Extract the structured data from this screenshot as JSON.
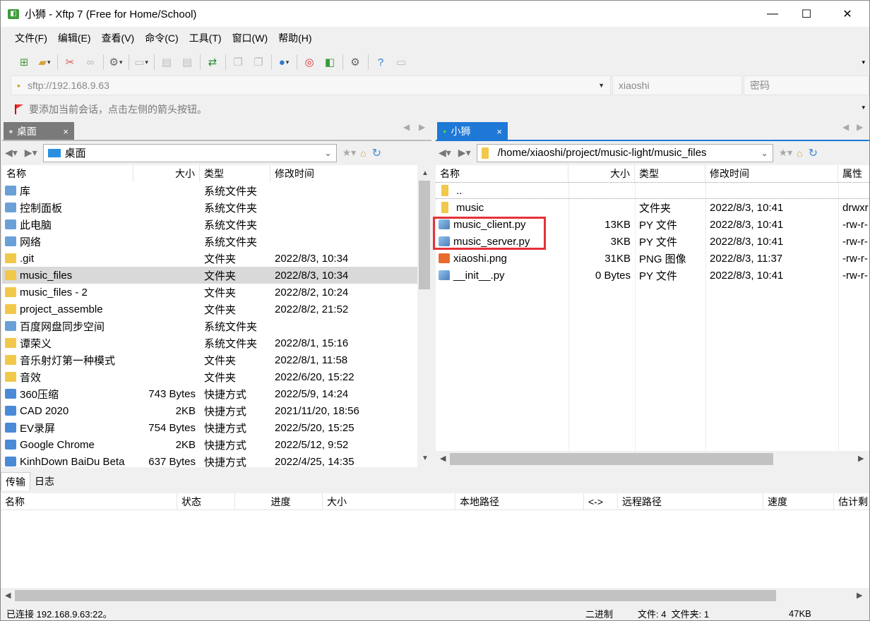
{
  "window": {
    "title": "小狮 - Xftp 7 (Free for Home/School)",
    "minimize": "—",
    "maximize": "☐",
    "close": "✕",
    "app_icon": "xftp-icon"
  },
  "menu": [
    "文件(F)",
    "编辑(E)",
    "查看(V)",
    "命令(C)",
    "工具(T)",
    "窗口(W)",
    "帮助(H)"
  ],
  "address": {
    "url": "sftp://192.168.9.63",
    "user": "xiaoshi",
    "password_placeholder": "密码"
  },
  "hint": "要添加当前会话，点击左侧的箭头按钮。",
  "left_tab": {
    "label": "桌面",
    "close": "×"
  },
  "right_tab": {
    "label": "小狮",
    "close": "×"
  },
  "left_path": "桌面",
  "right_path": "/home/xiaoshi/project/music-light/music_files",
  "left_columns": [
    "名称",
    "大小",
    "类型",
    "修改时间"
  ],
  "right_columns": [
    "名称",
    "大小",
    "类型",
    "修改时间",
    "属性"
  ],
  "left_files": [
    {
      "name": "库",
      "size": "",
      "type": "系统文件夹",
      "modified": "",
      "icon": "library-icon"
    },
    {
      "name": "控制面板",
      "size": "",
      "type": "系统文件夹",
      "modified": "",
      "icon": "control-panel-icon"
    },
    {
      "name": "此电脑",
      "size": "",
      "type": "系统文件夹",
      "modified": "",
      "icon": "computer-icon"
    },
    {
      "name": "网络",
      "size": "",
      "type": "系统文件夹",
      "modified": "",
      "icon": "network-icon"
    },
    {
      "name": ".git",
      "size": "",
      "type": "文件夹",
      "modified": "2022/8/3, 10:34",
      "icon": "folder-icon"
    },
    {
      "name": "music_files",
      "size": "",
      "type": "文件夹",
      "modified": "2022/8/3, 10:34",
      "icon": "folder-icon"
    },
    {
      "name": "music_files - 2",
      "size": "",
      "type": "文件夹",
      "modified": "2022/8/2, 10:24",
      "icon": "folder-icon"
    },
    {
      "name": "project_assemble",
      "size": "",
      "type": "文件夹",
      "modified": "2022/8/2, 21:52",
      "icon": "folder-icon"
    },
    {
      "name": "百度网盘同步空间",
      "size": "",
      "type": "系统文件夹",
      "modified": "",
      "icon": "baidu-sync-icon"
    },
    {
      "name": "谭荣义",
      "size": "",
      "type": "系统文件夹",
      "modified": "2022/8/1, 15:16",
      "icon": "user-folder-icon"
    },
    {
      "name": "音乐射灯第一种模式",
      "size": "",
      "type": "文件夹",
      "modified": "2022/8/1, 11:58",
      "icon": "folder-icon"
    },
    {
      "name": "音效",
      "size": "",
      "type": "文件夹",
      "modified": "2022/6/20, 15:22",
      "icon": "folder-icon"
    },
    {
      "name": "360压缩",
      "size": "743 Bytes",
      "type": "快捷方式",
      "modified": "2022/5/9, 14:24",
      "icon": "shortcut-icon"
    },
    {
      "name": "CAD 2020",
      "size": "2KB",
      "type": "快捷方式",
      "modified": "2021/11/20, 18:56",
      "icon": "shortcut-icon"
    },
    {
      "name": "EV录屏",
      "size": "754 Bytes",
      "type": "快捷方式",
      "modified": "2022/5/20, 15:25",
      "icon": "shortcut-icon"
    },
    {
      "name": "Google Chrome",
      "size": "2KB",
      "type": "快捷方式",
      "modified": "2022/5/12, 9:52",
      "icon": "shortcut-icon"
    },
    {
      "name": "KinhDown BaiDu Beta",
      "size": "637 Bytes",
      "type": "快捷方式",
      "modified": "2022/4/25, 14:35",
      "icon": "shortcut-icon"
    }
  ],
  "right_files": [
    {
      "name": "..",
      "size": "",
      "type": "",
      "modified": "",
      "attr": "",
      "icon": "folder-icon"
    },
    {
      "name": "music",
      "size": "",
      "type": "文件夹",
      "modified": "2022/8/3, 10:41",
      "attr": "drwxr",
      "icon": "folder-icon"
    },
    {
      "name": "music_client.py",
      "size": "13KB",
      "type": "PY 文件",
      "modified": "2022/8/3, 10:41",
      "attr": "-rw-r-",
      "icon": "python-file-icon"
    },
    {
      "name": "music_server.py",
      "size": "3KB",
      "type": "PY 文件",
      "modified": "2022/8/3, 10:41",
      "attr": "-rw-r-",
      "icon": "python-file-icon"
    },
    {
      "name": "xiaoshi.png",
      "size": "31KB",
      "type": "PNG 图像",
      "modified": "2022/8/3, 11:37",
      "attr": "-rw-r-",
      "icon": "image-file-icon"
    },
    {
      "name": "__init__.py",
      "size": "0 Bytes",
      "type": "PY 文件",
      "modified": "2022/8/3, 10:41",
      "attr": "-rw-r-",
      "icon": "python-file-icon"
    }
  ],
  "bottom_tabs": [
    "传输",
    "日志"
  ],
  "transfer_columns": [
    "名称",
    "状态",
    "进度",
    "大小",
    "本地路径",
    "<->",
    "远程路径",
    "速度",
    "估计剩"
  ],
  "status": {
    "connection": "已连接 192.168.9.63:22。",
    "mode": "二进制",
    "counts": "文件: 4  文件夹: 1",
    "size": "47KB"
  }
}
